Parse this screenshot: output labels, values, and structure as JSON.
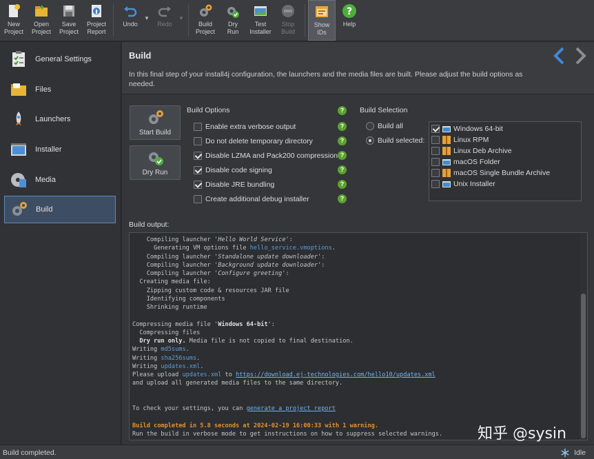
{
  "toolbar": {
    "new_project": "New\nProject",
    "open_project": "Open\nProject",
    "save_project": "Save\nProject",
    "project_report": "Project\nReport",
    "undo": "Undo",
    "redo": "Redo",
    "build_project": "Build\nProject",
    "dry_run": "Dry\nRun",
    "test_installer": "Test\nInstaller",
    "stop_build": "Stop\nBuild",
    "show_ids": "Show\nIDs",
    "help": "Help"
  },
  "sidebar": {
    "items": [
      {
        "label": "General Settings"
      },
      {
        "label": "Files"
      },
      {
        "label": "Launchers"
      },
      {
        "label": "Installer"
      },
      {
        "label": "Media"
      },
      {
        "label": "Build"
      }
    ]
  },
  "header": {
    "title": "Build",
    "description": "In this final step of your install4j configuration, the launchers and the media files are built. Please adjust the build options as needed."
  },
  "actions": {
    "start_build": "Start Build",
    "dry_run": "Dry Run"
  },
  "build_options": {
    "title": "Build Options",
    "items": [
      {
        "label": "Enable extra verbose output",
        "checked": false
      },
      {
        "label": "Do not delete temporary directory",
        "checked": false
      },
      {
        "label": "Disable LZMA and Pack200 compression",
        "checked": true
      },
      {
        "label": "Disable code signing",
        "checked": true
      },
      {
        "label": "Disable JRE bundling",
        "checked": true
      },
      {
        "label": "Create additional debug installer",
        "checked": false
      }
    ]
  },
  "build_selection": {
    "title": "Build Selection",
    "build_all": "Build all",
    "build_selected": "Build selected:",
    "selected_mode": "build_selected",
    "media": [
      {
        "label": "Windows 64-bit",
        "checked": true,
        "icon": "windows-icon"
      },
      {
        "label": "Linux RPM",
        "checked": false,
        "icon": "linux-rpm-icon"
      },
      {
        "label": "Linux Deb Archive",
        "checked": false,
        "icon": "linux-deb-icon"
      },
      {
        "label": "macOS Folder",
        "checked": false,
        "icon": "macos-folder-icon"
      },
      {
        "label": "macOS Single Bundle Archive",
        "checked": false,
        "icon": "macos-bundle-icon"
      },
      {
        "label": "Unix Installer",
        "checked": false,
        "icon": "unix-installer-icon"
      }
    ]
  },
  "output": {
    "label": "Build output:",
    "lines": [
      {
        "indent": "    ",
        "parts": [
          {
            "t": "Compiling launcher '"
          },
          {
            "t": "Hello World Service",
            "s": "i"
          },
          {
            "t": "':"
          }
        ]
      },
      {
        "indent": "      ",
        "parts": [
          {
            "t": "Generating VM options file "
          },
          {
            "t": "hello_service.vmoptions",
            "s": "link"
          },
          {
            "t": "."
          }
        ]
      },
      {
        "indent": "    ",
        "parts": [
          {
            "t": "Compiling launcher '"
          },
          {
            "t": "Standalone update downloader",
            "s": "i"
          },
          {
            "t": "':"
          }
        ]
      },
      {
        "indent": "    ",
        "parts": [
          {
            "t": "Compiling launcher '"
          },
          {
            "t": "Background update downloader",
            "s": "i"
          },
          {
            "t": "':"
          }
        ]
      },
      {
        "indent": "    ",
        "parts": [
          {
            "t": "Compiling launcher '"
          },
          {
            "t": "Configure greeting",
            "s": "i"
          },
          {
            "t": "':"
          }
        ]
      },
      {
        "indent": "  ",
        "parts": [
          {
            "t": "Creating media file:"
          }
        ]
      },
      {
        "indent": "    ",
        "parts": [
          {
            "t": "Zipping custom code & resources JAR file"
          }
        ]
      },
      {
        "indent": "    ",
        "parts": [
          {
            "t": "Identifying components"
          }
        ]
      },
      {
        "indent": "    ",
        "parts": [
          {
            "t": "Shrinking runtime"
          }
        ]
      },
      {
        "indent": "",
        "parts": []
      },
      {
        "indent": "",
        "parts": [
          {
            "t": "Compressing media file '"
          },
          {
            "t": "Windows 64-bit",
            "s": "b"
          },
          {
            "t": "':"
          }
        ]
      },
      {
        "indent": "  ",
        "parts": [
          {
            "t": "Compressing files"
          }
        ]
      },
      {
        "indent": "  ",
        "parts": [
          {
            "t": "Dry run only.",
            "s": "b"
          },
          {
            "t": " Media file is not copied to final destination."
          }
        ]
      },
      {
        "indent": "",
        "parts": [
          {
            "t": "Writing "
          },
          {
            "t": "md5sums",
            "s": "link"
          },
          {
            "t": "."
          }
        ]
      },
      {
        "indent": "",
        "parts": [
          {
            "t": "Writing "
          },
          {
            "t": "sha256sums",
            "s": "link"
          },
          {
            "t": "."
          }
        ]
      },
      {
        "indent": "",
        "parts": [
          {
            "t": "Writing "
          },
          {
            "t": "updates.xml",
            "s": "link"
          },
          {
            "t": "."
          }
        ]
      },
      {
        "indent": "",
        "parts": [
          {
            "t": "Please upload "
          },
          {
            "t": "updates.xml",
            "s": "link"
          },
          {
            "t": " to "
          },
          {
            "t": "https://download.ej-technologies.com/hello10/updates.xml",
            "s": "url"
          }
        ]
      },
      {
        "indent": "",
        "parts": [
          {
            "t": "and upload all generated media files to the same directory."
          }
        ]
      },
      {
        "indent": "",
        "parts": []
      },
      {
        "indent": "",
        "parts": []
      },
      {
        "indent": "",
        "parts": [
          {
            "t": "To check your settings, you can "
          },
          {
            "t": "generate a project report",
            "s": "url"
          }
        ]
      },
      {
        "indent": "",
        "parts": []
      },
      {
        "indent": "",
        "parts": [
          {
            "t": "Build completed in 5.8 seconds at 2024-02-19 16:00:33 with 1 warning.",
            "s": "warn"
          }
        ]
      },
      {
        "indent": "",
        "parts": [
          {
            "t": "Run the build in verbose mode to get instructions on how to suppress selected warnings."
          }
        ]
      }
    ]
  },
  "status": {
    "message": "Build completed.",
    "state": "Idle"
  },
  "watermark": "知乎 @sysin",
  "colors": {
    "accent": "#6089b8",
    "help_green": "#5aa32b",
    "warning": "#e8902a",
    "link": "#5f9dd6"
  }
}
